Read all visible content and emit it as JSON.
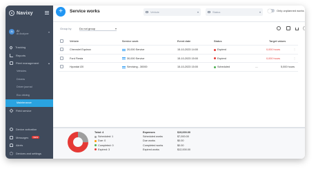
{
  "app": {
    "brand": "Navixy"
  },
  "user": {
    "initials": "AI",
    "name": "AI",
    "org": "AI Analyzer"
  },
  "sidebar": {
    "items": [
      {
        "label": "Tracking",
        "icon": "pin-icon"
      },
      {
        "label": "Reports",
        "icon": "chart-icon"
      },
      {
        "label": "Fleet management",
        "icon": "fleet-icon",
        "expanded": true
      }
    ],
    "sub_items": [
      {
        "label": "Vehicles",
        "active": false
      },
      {
        "label": "Drivers",
        "active": false
      },
      {
        "label": "Driver journal",
        "active": false
      },
      {
        "label": "Eco driving",
        "active": false
      },
      {
        "label": "Maintenance",
        "active": true
      }
    ],
    "after_items": [
      {
        "label": "Field service",
        "icon": "cube-icon"
      }
    ],
    "lower_items": [
      {
        "label": "Device activation",
        "icon": "clock-icon"
      },
      {
        "label": "Messages",
        "icon": "msg-icon",
        "badge": "NEW"
      },
      {
        "label": "Alerts",
        "icon": "bell-icon"
      },
      {
        "label": "Devices and settings",
        "icon": "gear-icon"
      }
    ]
  },
  "header": {
    "title": "Service works",
    "add_button": "+",
    "vehicle_filter_placeholder": "Vehicle",
    "status_filter_placeholder": "Status",
    "toggle_label": "Only unplanned works"
  },
  "subbar": {
    "group_label": "Group by",
    "group_value": "Do not group"
  },
  "table": {
    "columns": [
      "Vehicle",
      "Service work",
      "Event date",
      "Status",
      "Target values"
    ],
    "rows": [
      {
        "vehicle": "Chevrolet Equinox",
        "service": "20,000 Service",
        "date": "15-10-2023 14:00",
        "status": "Expired",
        "status_color": "#e53935",
        "target_a": "0,000 hours",
        "target_b": "",
        "target_red": true
      },
      {
        "vehicle": "Ford Fiesta",
        "service": "30,000 Service",
        "date": "15-10-2023 15:00",
        "status": "Expired",
        "status_color": "#e53935",
        "target_a": "0,000 hours",
        "target_b": "",
        "target_red": true
      },
      {
        "vehicle": "Hyundai i20",
        "service": "Servicing - 30000",
        "date": "15-10-2023 15:00",
        "status": "Scheduled",
        "status_color": "#4caf50",
        "target_a": "—",
        "target_b": "5,000 hours",
        "target_red": false
      }
    ]
  },
  "summary": {
    "total_label": "Total: 4",
    "legend": [
      {
        "label": "Scheduled: 1",
        "color": "#9e9e9e",
        "value": 1
      },
      {
        "label": "Due: 0",
        "color": "#ff9800",
        "value": 0
      },
      {
        "label": "Completed: 0",
        "color": "#4caf50",
        "value": 0
      },
      {
        "label": "Expired: 3",
        "color": "#e53935",
        "value": 3
      }
    ],
    "expenses": [
      {
        "label": "Expenses",
        "value": "$19,000.00",
        "head": true
      },
      {
        "label": "Scheduled works",
        "value": "$7,000.00"
      },
      {
        "label": "Due works",
        "value": "$0.00"
      },
      {
        "label": "Completed works",
        "value": "$0.00"
      },
      {
        "label": "Expired works",
        "value": "$12,000.00"
      }
    ]
  },
  "colors": {
    "accent": "#2196f3",
    "active_nav": "#2aa3e0",
    "sidebar": "#3f4a5b"
  }
}
